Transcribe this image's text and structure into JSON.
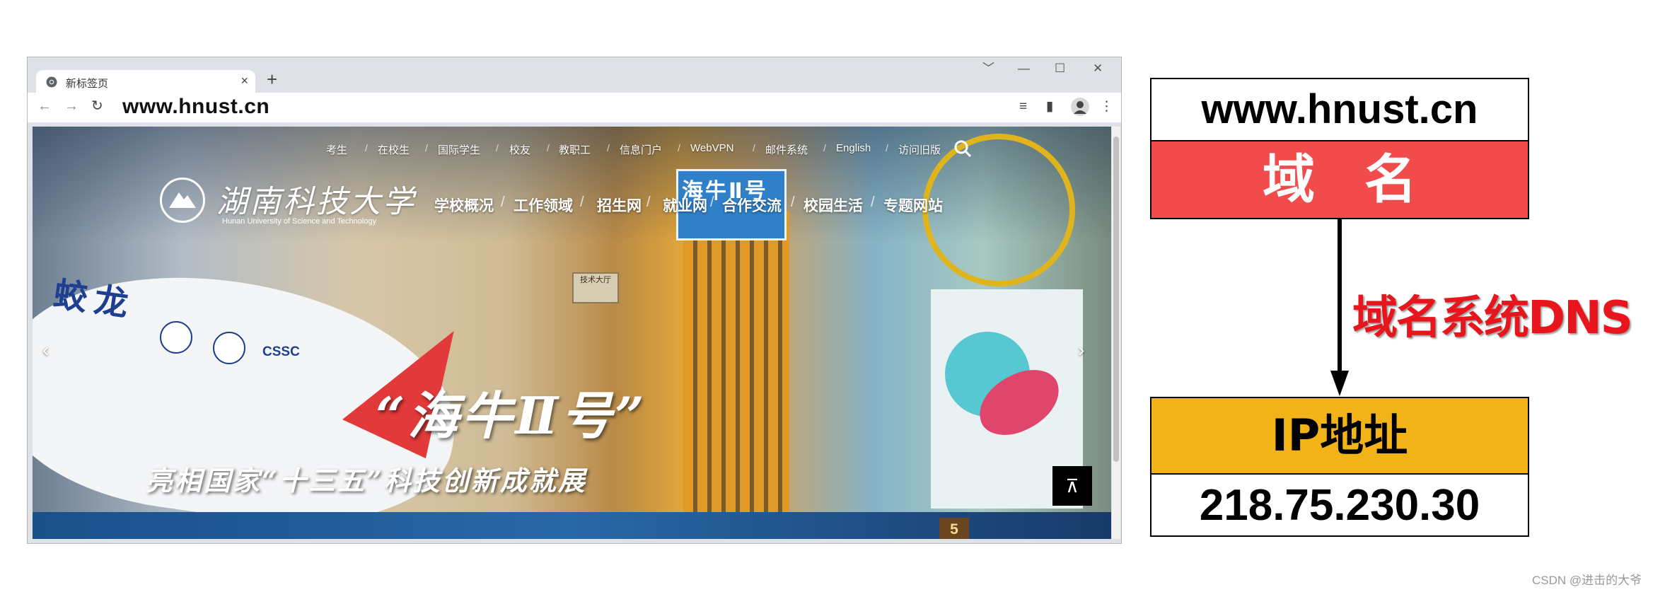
{
  "browser": {
    "tab_title": "新标签页",
    "tab_close": "×",
    "new_tab": "+",
    "controls": {
      "dropdown": "﹀",
      "minimize": "—",
      "maximize": "☐",
      "close": "✕"
    },
    "nav": {
      "back": "←",
      "forward": "→",
      "reload": "↻"
    },
    "url": "www.hnust.cn",
    "toolbar_icons": [
      "playlist-icon",
      "sidepanel-icon",
      "profile-icon",
      "menu-icon"
    ],
    "toolbar_glyphs": {
      "playlist": "≡",
      "sidepanel": "▮",
      "menu": "⋮"
    }
  },
  "site": {
    "top_links": [
      "考生",
      "在校生",
      "国际学生",
      "校友",
      "教职工",
      "信息门户",
      "WebVPN",
      "邮件系统",
      "English",
      "访问旧版"
    ],
    "separator": "/",
    "logo_cn": "湖南科技大学",
    "logo_en": "Hunan University of Science and Technology",
    "main_links": [
      "学校概况",
      "工作领域",
      "招生网",
      "就业网",
      "合作交流",
      "校园生活",
      "专题网站"
    ],
    "banner_jiaolong": "蛟龙",
    "banner_cssc": "CSSC",
    "tower_sign": "海牛Ⅱ号",
    "building_sign": "技术大厅",
    "headline": "“海牛Ⅱ号”",
    "subline": "亮相国家“十三五”科技创新成就展",
    "prev_arrow": "‹",
    "next_arrow": "›",
    "back_to_top": "⊼",
    "page_badge": "5"
  },
  "diagram": {
    "domain_value": "www.hnust.cn",
    "domain_label": "域名",
    "system_label": "域名系统DNS",
    "ip_label": "IP地址",
    "ip_value": "218.75.230.30",
    "colors": {
      "domain_box": "#f14b4b",
      "ip_box": "#f2b318",
      "dns_text": "#e8161c"
    }
  },
  "watermark": "CSDN @进击的大爷"
}
